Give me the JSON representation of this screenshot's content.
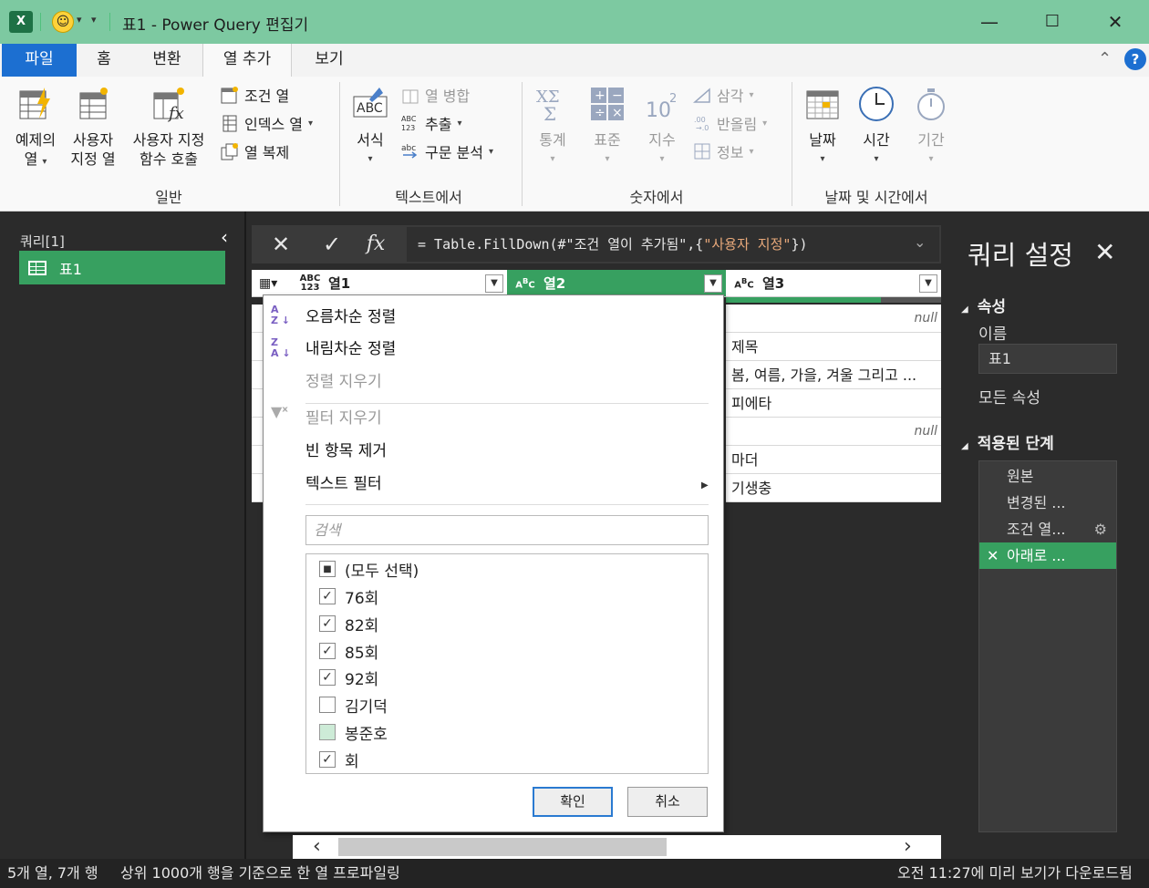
{
  "window": {
    "title": "표1 - Power Query 편집기",
    "excel_icon": "X",
    "minimize": "—",
    "maximize": "☐",
    "close": "✕"
  },
  "tabs": [
    {
      "label": "파일"
    },
    {
      "label": "홈"
    },
    {
      "label": "변환"
    },
    {
      "label": "열 추가"
    },
    {
      "label": "보기"
    }
  ],
  "ribbon": {
    "general": {
      "label": "일반",
      "example_col": [
        "예제의",
        "열"
      ],
      "custom_col": [
        "사용자",
        "지정 열"
      ],
      "invoke_fn": [
        "사용자 지정",
        "함수 호출"
      ],
      "conditional_col": "조건 열",
      "index_col": "인덱스 열",
      "duplicate_col": "열 복제"
    },
    "text": {
      "label": "텍스트에서",
      "format": "서식",
      "merge_cols": "열 병합",
      "extract": "추출",
      "parse": "구문 분석"
    },
    "number": {
      "label": "숫자에서",
      "statistics": "통계",
      "standard": "표준",
      "scientific": "지수",
      "trig": "삼각",
      "rounding": "반올림",
      "info": "정보"
    },
    "datetime": {
      "label": "날짜 및 시간에서",
      "date": "날짜",
      "time": "시간",
      "duration": "기간"
    }
  },
  "queries": {
    "title": "쿼리[1]",
    "items": [
      {
        "label": "표1"
      }
    ]
  },
  "formula": {
    "prefix": "= Table.FillDown(#\"조건 열이 추가됨\",{",
    "arg": "\"사용자 지정\"",
    "suffix": "})"
  },
  "grid": {
    "columns": [
      {
        "type": "ABC\n123",
        "name": "열1"
      },
      {
        "type": "ABC",
        "name": "열2"
      },
      {
        "type": "ABC",
        "name": "열3"
      }
    ],
    "col3_rows": [
      "null",
      "제목",
      "봄, 여름, 가을, 겨울 그리고 ...",
      "피에타",
      "null",
      "마더",
      "기생충"
    ]
  },
  "menu": {
    "sort_asc": "오름차순 정렬",
    "sort_desc": "내림차순 정렬",
    "clear_sort": "정렬 지우기",
    "clear_filter": "필터 지우기",
    "remove_empty": "빈 항목 제거",
    "text_filter": "텍스트 필터",
    "search_placeholder": "검색",
    "values": [
      {
        "label": "(모두 선택)",
        "state": "partial"
      },
      {
        "label": "76회",
        "state": "checked"
      },
      {
        "label": "82회",
        "state": "checked"
      },
      {
        "label": "85회",
        "state": "checked"
      },
      {
        "label": "92회",
        "state": "checked"
      },
      {
        "label": "김기덕",
        "state": "unchecked"
      },
      {
        "label": "봉준호",
        "state": "highlight"
      },
      {
        "label": "회",
        "state": "checked"
      }
    ],
    "ok": "확인",
    "cancel": "취소"
  },
  "settings": {
    "title": "쿼리 설정",
    "properties": "속성",
    "name_label": "이름",
    "name_value": "표1",
    "all_properties": "모든 속성",
    "applied_steps": "적용된 단계",
    "steps": [
      {
        "label": "원본"
      },
      {
        "label": "변경된 ..."
      },
      {
        "label": "조건 열..."
      },
      {
        "label": "아래로 ..."
      }
    ]
  },
  "status": {
    "left": "5개 열, 7개 행",
    "profiling": "상위 1000개 행을 기준으로 한 열 프로파일링",
    "right": "오전 11:27에 미리 보기가 다운로드됨"
  },
  "colors": {
    "title_bar": "#7dc9a1",
    "accent_green": "#37a060",
    "file_tab": "#1c6fd1",
    "dark_bg": "#2b2b2b"
  }
}
